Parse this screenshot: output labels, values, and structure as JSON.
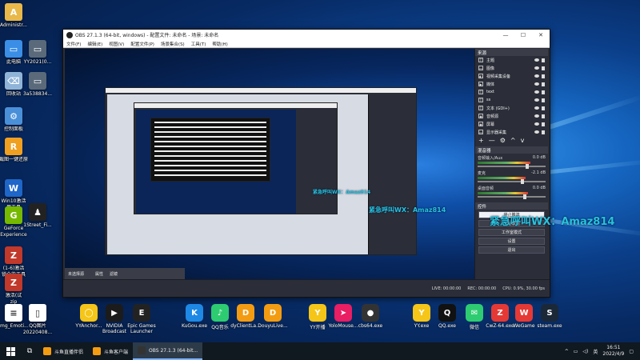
{
  "desktop": {
    "icons_left": [
      {
        "label": "Administr...",
        "color": "#e8b84a",
        "glyph": "A"
      },
      {
        "label": "此电脑",
        "color": "#3a8ee6",
        "glyph": "▭"
      },
      {
        "label": "回收站",
        "color": "#8fb4d8",
        "glyph": "⌫"
      },
      {
        "label": "控制面板",
        "color": "#4a90d9",
        "glyph": "⚙"
      },
      {
        "label": "截图一键还原",
        "color": "#f0a020",
        "glyph": "R"
      },
      {
        "label": "Win10激活\n用工具",
        "color": "#1e66c8",
        "glyph": "W"
      },
      {
        "label": "GeForce\nExperience",
        "color": "#76b900",
        "glyph": "G"
      },
      {
        "label": "(1-6)激活\n锁全能工具",
        "color": "#c0392b",
        "glyph": "Z"
      },
      {
        "label": "激活(试\nzip",
        "color": "#c0392b",
        "glyph": "Z"
      },
      {
        "label": "Img_Emoti...",
        "color": "#ffffff",
        "glyph": "≡"
      }
    ],
    "icons_col2": [
      {
        "label": "YY2021(0...",
        "color": "#5a6a7a",
        "glyph": "▭"
      },
      {
        "label": "3a538834...",
        "color": "#5a6a7a",
        "glyph": "▭"
      },
      {
        "label": "1Street_Fi...",
        "color": "#222",
        "glyph": "♟"
      },
      {
        "label": "QQ图片\n20220408...",
        "color": "#ffffff",
        "glyph": "▯"
      }
    ],
    "bottom_icons": [
      {
        "label": "YYAnchor...",
        "color": "#f5c518",
        "glyph": "◯"
      },
      {
        "label": "NVIDIA\nBroadcast",
        "color": "#1b1b1b",
        "glyph": "▶"
      },
      {
        "label": "Epic Games\nLauncher",
        "color": "#222",
        "glyph": "E"
      },
      {
        "label": "KuGou.exe",
        "color": "#1e88e5",
        "glyph": "K"
      },
      {
        "label": "QQ音乐",
        "color": "#2ecc71",
        "glyph": "♪"
      },
      {
        "label": "dyClientLa...",
        "color": "#f39c12",
        "glyph": "D"
      },
      {
        "label": "DouyuLive...",
        "color": "#f39c12",
        "glyph": "D"
      },
      {
        "label": "YY开播",
        "color": "#f5c518",
        "glyph": "Y"
      },
      {
        "label": "YoloMouse...",
        "color": "#e91e63",
        "glyph": "➤"
      },
      {
        "label": "cbs64.exe",
        "color": "#333",
        "glyph": "●"
      },
      {
        "label": "YY.exe",
        "color": "#f5c518",
        "glyph": "Y"
      },
      {
        "label": "QQ.exe",
        "color": "#111",
        "glyph": "Q"
      },
      {
        "label": "微信",
        "color": "#2ecc71",
        "glyph": "✉"
      },
      {
        "label": "CwZ-64.exe",
        "color": "#e53935",
        "glyph": "Z"
      },
      {
        "label": "WeGame",
        "color": "#e53935",
        "glyph": "W"
      },
      {
        "label": "steam.exe",
        "color": "#1b2838",
        "glyph": "S"
      }
    ]
  },
  "obs": {
    "title": "OBS 27.1.3 (64-bit, windows) - 配置文件: 未命名 - 场景: 未命名",
    "window_controls": [
      "—",
      "☐",
      "✕"
    ],
    "menu": [
      "文件(F)",
      "编辑(E)",
      "视图(V)",
      "配置文件(P)",
      "场景集合(S)",
      "工具(T)",
      "帮助(H)"
    ],
    "sources_header": "来源",
    "sources": [
      {
        "icon": "T",
        "label": "主题"
      },
      {
        "icon": "▭",
        "label": "图像"
      },
      {
        "icon": "◐",
        "label": "视频采集设备"
      },
      {
        "icon": "▶",
        "label": "媒体"
      },
      {
        "icon": "T",
        "label": "text"
      },
      {
        "icon": "T",
        "label": "ss"
      },
      {
        "icon": "T",
        "label": "文本 (GDI+)"
      },
      {
        "icon": "◉",
        "label": "音频源"
      },
      {
        "icon": "◉",
        "label": "屏幕"
      },
      {
        "icon": "▭",
        "label": "显示器采集"
      }
    ],
    "source_tools": [
      "+",
      "—",
      "⚙",
      "^",
      "v"
    ],
    "mixer_header": "混音器",
    "mixer": [
      {
        "name": "音频输入/Aux",
        "db": "0.0 dB",
        "level": 0.78
      },
      {
        "name": "麦克",
        "db": "-2.1 dB",
        "level": 0.7
      },
      {
        "name": "桌面音频",
        "db": "0.0 dB",
        "level": 0.74
      }
    ],
    "controls_header": "控件",
    "controls": [
      "停止推流",
      "开始录制",
      "工作室模式",
      "设置",
      "退出"
    ],
    "scene_name": "未选择源",
    "scene_tools": [
      "属性",
      "滤镜"
    ],
    "status": {
      "live": "LIVE: 00:00:00",
      "rec": "REC: 00:00:00",
      "cpu": "CPU: 0.9%, 30.00 fps"
    },
    "overlay_texts": [
      "紧急呼叫WX：Amaz814",
      "紧急呼叫WX：Amaz814",
      "紧急呼叫WX：Amaz814"
    ]
  },
  "taskbar": {
    "items": [
      {
        "label": "斗鱼直播伴侣",
        "color": "#f39c12"
      },
      {
        "label": "斗鱼客户端",
        "color": "#f39c12"
      },
      {
        "label": "OBS 27.1.3 (64-bit...",
        "color": "#333"
      }
    ],
    "time": "16:51",
    "date": "2022/4/9"
  }
}
